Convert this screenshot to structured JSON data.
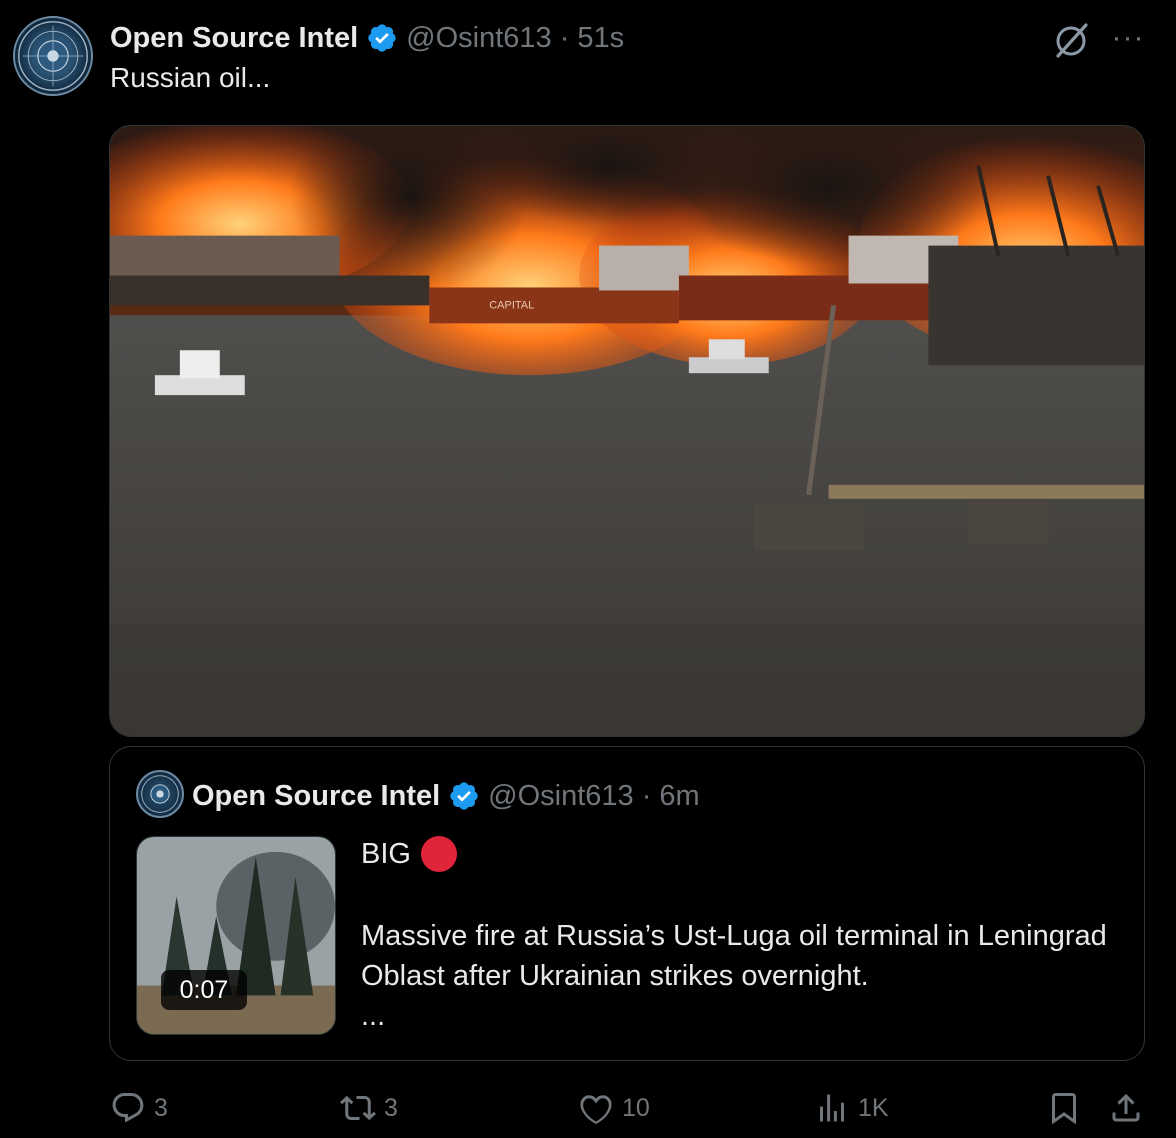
{
  "tweet": {
    "author_name": "Open Source Intel",
    "handle": "@Osint613",
    "separator": "·",
    "time": "51s",
    "text": "Russian oil...",
    "more_label": "···"
  },
  "media": {
    "ship_label": "CAPITAL"
  },
  "quote": {
    "author_name": "Open Source Intel",
    "handle": "@Osint613",
    "separator": "·",
    "time": "6m",
    "big_label": "BIG",
    "body": "Massive fire at Russia’s Ust-Luga oil terminal in Leningrad Oblast after Ukrainian strikes overnight.",
    "ellipsis": "...",
    "video_duration": "0:07"
  },
  "actions": {
    "replies": "3",
    "reposts": "3",
    "likes": "10",
    "views": "1K"
  },
  "colors": {
    "background": "#000000",
    "text": "#e7e9ea",
    "muted": "#71767b",
    "border": "#2f3336",
    "verified": "#1d9bf0",
    "red_dot": "#e0243a"
  },
  "icons": [
    "verified-badge-icon",
    "grok-icon",
    "more-icon",
    "reply-icon",
    "repost-icon",
    "like-icon",
    "views-icon",
    "bookmark-icon",
    "share-icon"
  ]
}
